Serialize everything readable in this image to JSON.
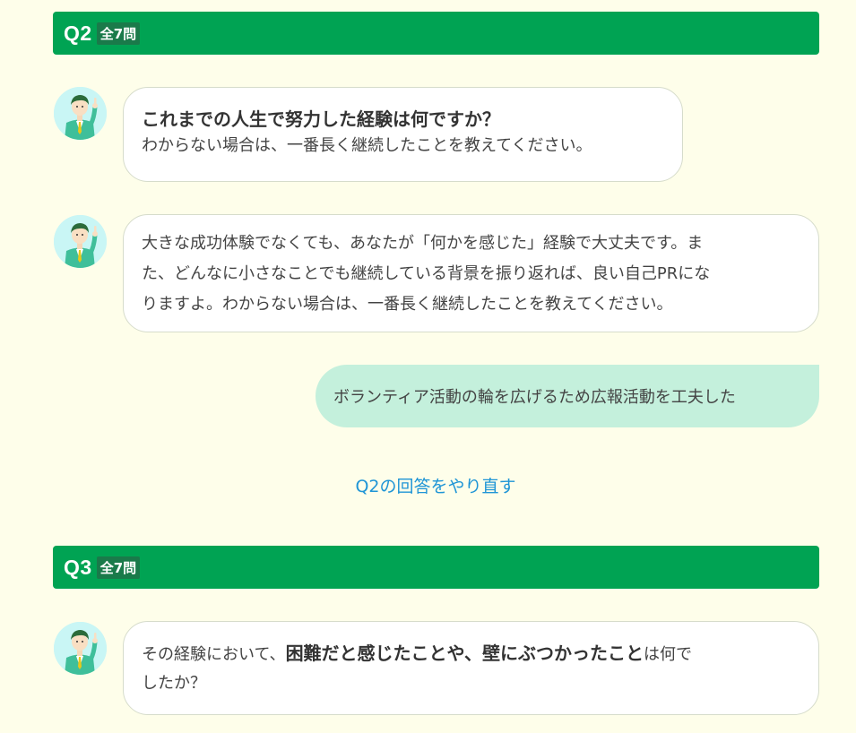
{
  "q2": {
    "number": "Q2",
    "total": "全7問",
    "message1": {
      "title": "これまでの人生で努力した経験は何ですか？",
      "text": "わからない場合は、一番長く継続したことを教えてください。"
    },
    "message2": {
      "line1": "大きな成功体験でなくても、あなたが「何かを感じた」経験で大丈夫です。ま",
      "line2": "た、どんなに小さなことでも継続している背景を振り返れば、良い自己PRにな",
      "line3": "りますよ。わからない場合は、一番長く継続したことを教えてください。"
    },
    "answer": "ボランティア活動の輪を広げるため広報活動を工夫した",
    "redo_link": "Q2の回答をやり直す"
  },
  "q3": {
    "number": "Q3",
    "total": "全7問",
    "message1": {
      "prefix": "その経験において、",
      "emphasis": "困難だと感じたことや、壁にぶつかったこと",
      "suffix": "は何で",
      "line2": "したか？"
    }
  },
  "colors": {
    "background": "#fefeea",
    "header_green": "#00a353",
    "answer_bubble": "#c4f0dc",
    "link_blue": "#1f95d6",
    "avatar_bg": "#c9f6f5"
  },
  "icons": {
    "avatar": "advisor-avatar-icon"
  }
}
